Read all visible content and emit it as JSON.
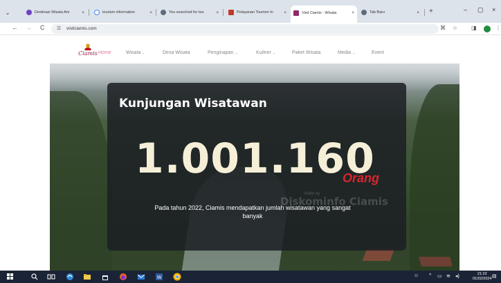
{
  "browser": {
    "tabs": [
      {
        "label": "Destinasi Wisata Am",
        "favicon_color": "#6f42c1",
        "active": false
      },
      {
        "label": "tourism information",
        "favicon_color": "#4285f4",
        "active": false
      },
      {
        "label": "You searched for tou",
        "favicon_color": "#5f6a7a",
        "active": false
      },
      {
        "label": "Pelayanan Tourism In",
        "favicon_color": "#c0392b",
        "active": false
      },
      {
        "label": "Visit Ciamis - Wisata",
        "favicon_color": "#8e2a6b",
        "active": true
      },
      {
        "label": "Tab Baru",
        "favicon_color": "#5f6a7a",
        "active": false
      }
    ],
    "close_glyph": "×",
    "new_tab_glyph": "+",
    "window_controls": {
      "minimize": "–",
      "maximize": "▢",
      "close": "×"
    },
    "url": "visitciamis.com",
    "nav": {
      "back": "←",
      "forward": "→",
      "reload": "C"
    }
  },
  "site": {
    "logo_text": "Ciamis",
    "nav_items": [
      {
        "label": "Home",
        "dropdown": false
      },
      {
        "label": "Wisata",
        "dropdown": true
      },
      {
        "label": "Desa Wisata",
        "dropdown": false
      },
      {
        "label": "Penginapan",
        "dropdown": true
      },
      {
        "label": "Kuliner",
        "dropdown": true
      },
      {
        "label": "Paket Wisata",
        "dropdown": false
      },
      {
        "label": "Media",
        "dropdown": true
      },
      {
        "label": "Event",
        "dropdown": false
      }
    ],
    "dropdown_glyph": "⌄"
  },
  "hero": {
    "title": "Kunjungan Wisatawan",
    "visitor_count": "1.001.160",
    "unit": "Orang",
    "description": "Pada tahun 2022, Ciamis mendapatkan jumlah wisatawan yang sangat banyak",
    "watermark": "Diskominfo Ciamis",
    "watermark_small": "Video by"
  },
  "taskbar": {
    "time": "21:22",
    "date": "01/02/2024"
  },
  "colors": {
    "nav_active": "#d97aa1",
    "unit_red": "#d7262f",
    "card_bg": "#1c2024"
  }
}
